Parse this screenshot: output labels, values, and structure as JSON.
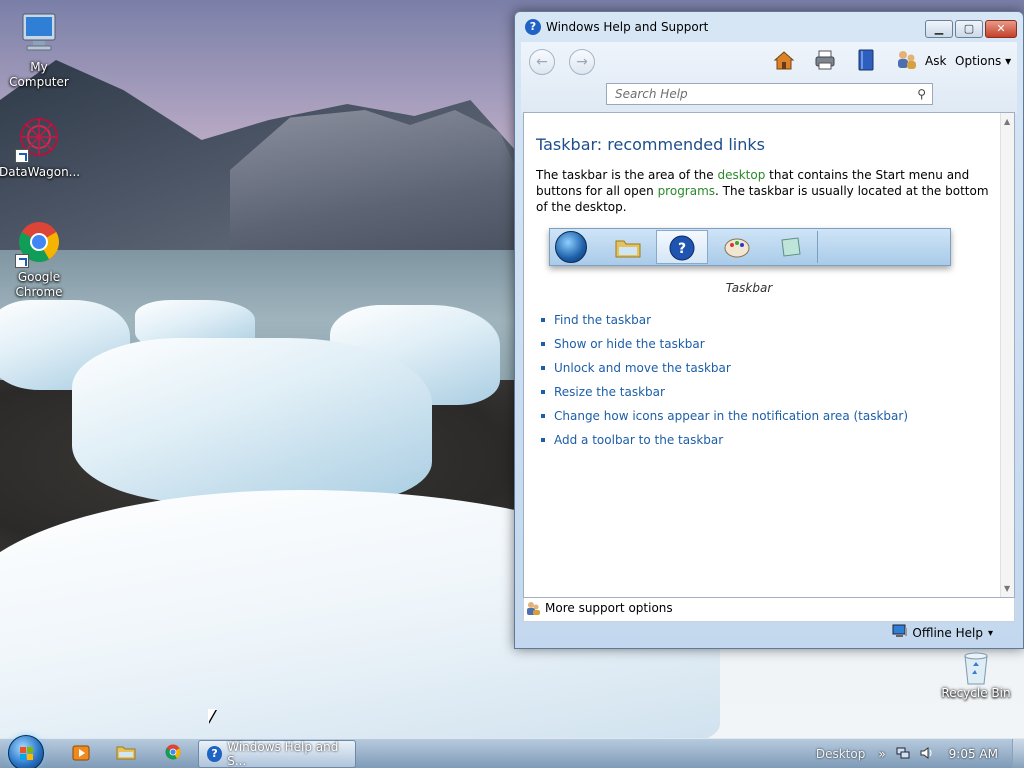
{
  "desktop": {
    "icons": [
      {
        "label": "My Computer"
      },
      {
        "label": "DataWagon..."
      },
      {
        "label": "Google Chrome"
      }
    ],
    "recycle_bin": "Recycle Bin"
  },
  "window": {
    "title": "Windows Help and Support",
    "toolbar": {
      "ask_label": "Ask",
      "options_label": "Options",
      "search_placeholder": "Search Help"
    },
    "content": {
      "heading": "Taskbar: recommended links",
      "intro_part1": "The taskbar is the area of the ",
      "intro_link1": "desktop",
      "intro_part2": " that contains the Start menu and buttons for all open ",
      "intro_link2": "programs",
      "intro_part3": ". The taskbar is usually located at the bottom of the desktop.",
      "figure_caption": "Taskbar",
      "links": [
        "Find the taskbar",
        "Show or hide the taskbar",
        "Unlock and move the taskbar",
        "Resize the taskbar",
        "Change how icons appear in the notification area (taskbar)",
        "Add a toolbar to the taskbar"
      ]
    },
    "footer": {
      "more_support": "More support options",
      "offline_help": "Offline Help"
    }
  },
  "taskbar": {
    "active_button": "Windows Help and S...",
    "desktop_label": "Desktop",
    "clock": "9:05 AM"
  }
}
